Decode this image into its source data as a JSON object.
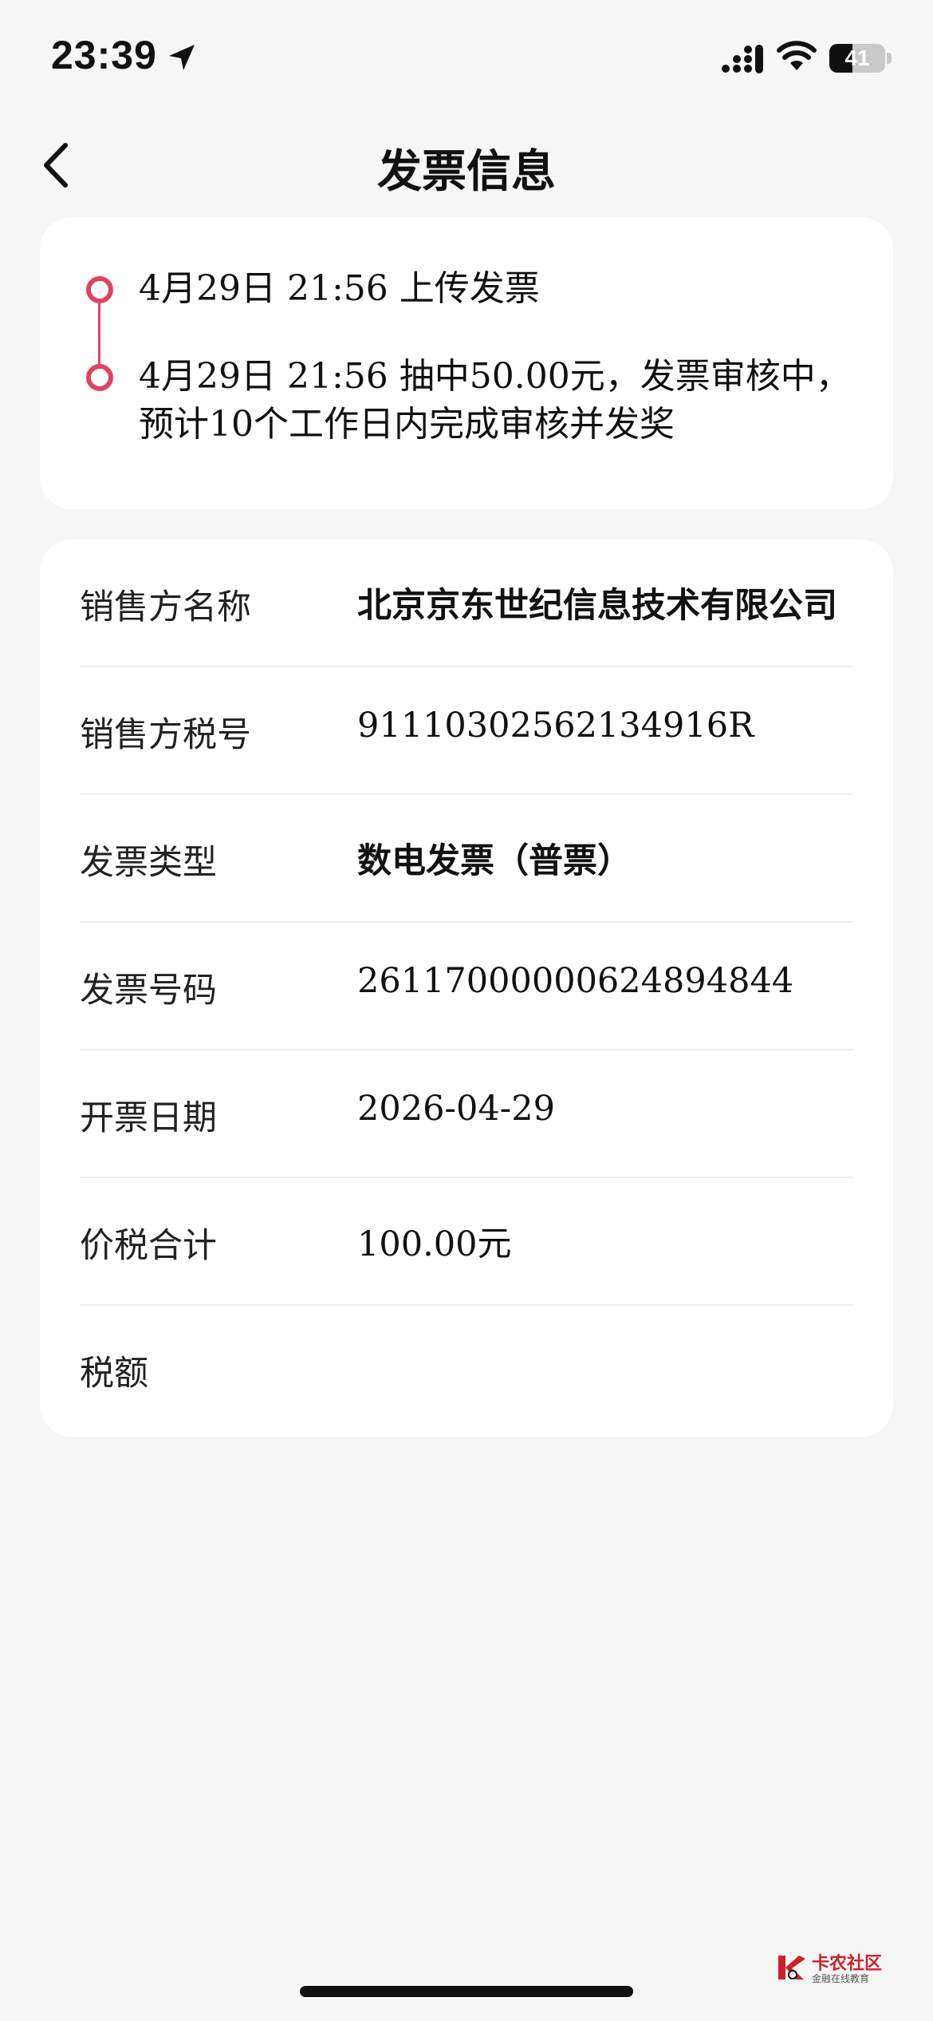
{
  "status_bar": {
    "time": "23:39",
    "battery": "41",
    "battery_level": 0.41,
    "icons": [
      "location-arrow-icon",
      "signal-icon",
      "wifi-icon",
      "battery-icon"
    ]
  },
  "nav": {
    "title": "发票信息",
    "back_icon": "chevron-left-icon"
  },
  "timeline": {
    "accent_color": "#e0435f",
    "events": [
      {
        "text": "4月29日 21:56 上传发票"
      },
      {
        "text": "4月29日 21:56 抽中50.00元，发票审核中，预计10个工作日内完成审核并发奖"
      }
    ]
  },
  "invoice": {
    "rows": [
      {
        "label": "销售方名称",
        "value": "北京京东世纪信息技术有限公司"
      },
      {
        "label": "销售方税号",
        "value": "91110302562134916R"
      },
      {
        "label": "发票类型",
        "value": "数电发票（普票）"
      },
      {
        "label": "发票号码",
        "value": "26117000000624894844"
      },
      {
        "label": "开票日期",
        "value": "2026-04-29"
      },
      {
        "label": "价税合计",
        "value": "100.00元"
      },
      {
        "label": "税额",
        "value": ""
      }
    ]
  },
  "watermark": {
    "title": "卡农社区",
    "subtitle": "金融在线教育"
  }
}
